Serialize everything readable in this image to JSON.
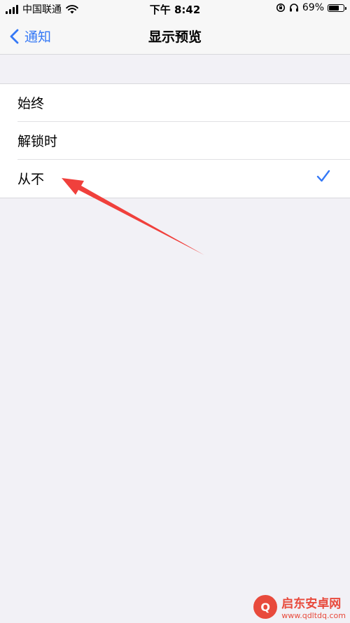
{
  "status_bar": {
    "carrier": "中国联通",
    "time": "下午 8:42",
    "battery_percent": "69%",
    "battery_level": 0.69
  },
  "nav": {
    "back_label": "通知",
    "title": "显示预览"
  },
  "options": [
    {
      "label": "始终",
      "selected": false
    },
    {
      "label": "解锁时",
      "selected": false
    },
    {
      "label": "从不",
      "selected": true
    }
  ],
  "colors": {
    "accent": "#3478f6",
    "background": "#f2f1f6",
    "annotation_arrow": "#f0403c"
  },
  "icons": {
    "back": "chevron-left-icon",
    "selected": "checkmark-icon",
    "wifi": "wifi-icon",
    "battery": "battery-icon",
    "headphones": "headphones-icon",
    "orientation_lock": "orientation-lock-icon"
  },
  "watermark": {
    "name": "启东安卓网",
    "url": "www.qdltdq.com"
  }
}
